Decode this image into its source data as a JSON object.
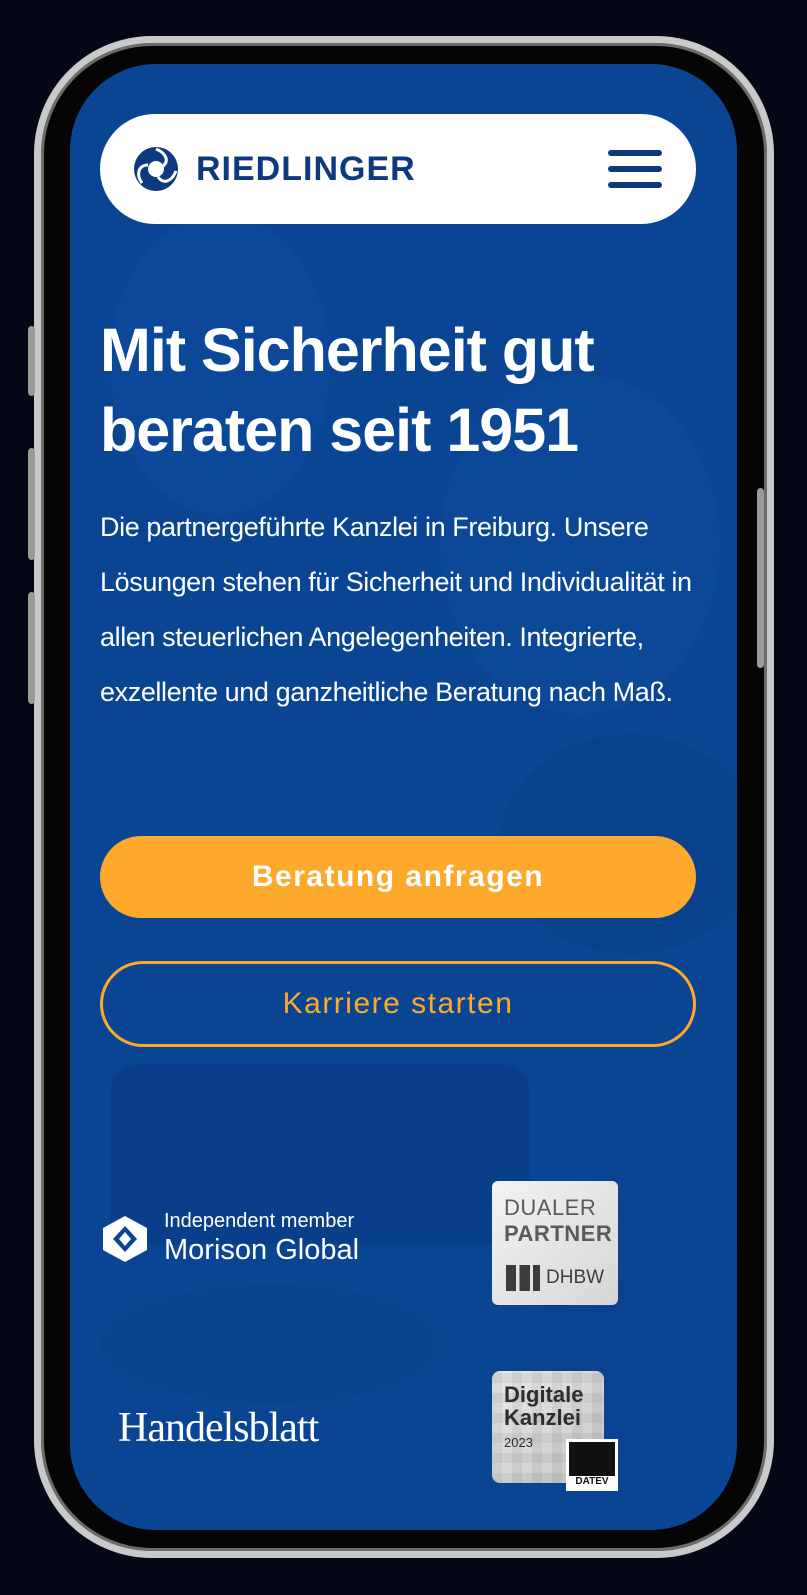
{
  "header": {
    "logo_text": "RIEDLINGER",
    "menu_icon": "hamburger-menu-icon"
  },
  "hero": {
    "headline": "Mit Sicherheit gut beraten seit 1951",
    "intro": "Die partnergeführte Kanzlei in Freiburg. Unsere Lösungen stehen für Sicherheit und Individualität in allen steuerlichen Angelegenheiten. Integrierte, exzellente und ganzheitliche Beratung nach Maß.",
    "primary_button": "Beratung anfragen",
    "secondary_button": "Karriere starten"
  },
  "badges": {
    "morison_small": "Independent member",
    "morison_big": "Morison Global",
    "dhbw_line1": "DUALER",
    "dhbw_line2": "PARTNER",
    "dhbw_foot": "DHBW",
    "handelsblatt": "Handelsblatt",
    "datev_title": "Digitale Kanzlei",
    "datev_year": "2023",
    "datev_label": "DATEV"
  },
  "colors": {
    "background": "#0a4594",
    "accent": "#fca92c",
    "logo_blue": "#0d3a7d"
  }
}
